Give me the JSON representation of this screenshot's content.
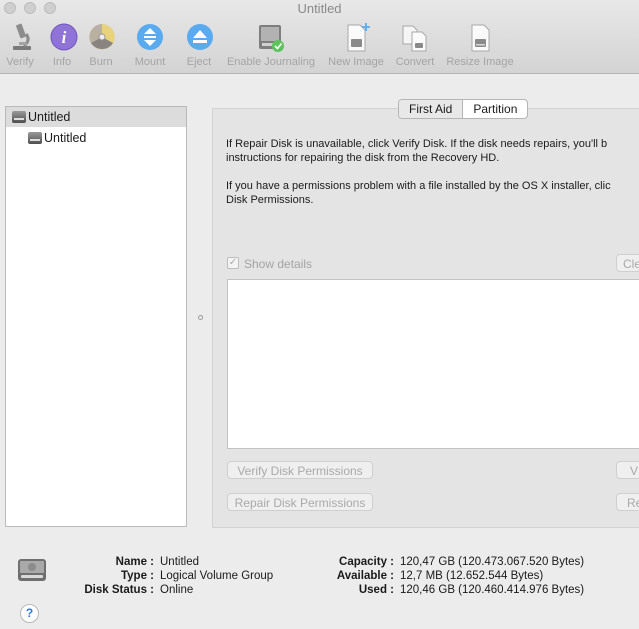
{
  "window": {
    "title": "Untitled"
  },
  "toolbar": {
    "items": [
      {
        "label": "Verify",
        "icon": "microscope-icon"
      },
      {
        "label": "Info",
        "icon": "info-icon"
      },
      {
        "label": "Burn",
        "icon": "burn-disc-icon"
      },
      {
        "label": "Mount",
        "icon": "mount-icon"
      },
      {
        "label": "Eject",
        "icon": "eject-icon"
      },
      {
        "label": "Enable Journaling",
        "icon": "journaling-icon"
      },
      {
        "label": "New Image",
        "icon": "new-image-icon"
      },
      {
        "label": "Convert",
        "icon": "convert-icon"
      },
      {
        "label": "Resize Image",
        "icon": "resize-image-icon"
      }
    ]
  },
  "sidebar": {
    "items": [
      {
        "label": "Untitled",
        "level": 0,
        "selected": true
      },
      {
        "label": "Untitled",
        "level": 1,
        "selected": false
      }
    ]
  },
  "tabs": [
    {
      "label": "First Aid",
      "active": true
    },
    {
      "label": "Partition",
      "active": false
    }
  ],
  "first_aid": {
    "para1_line1": "If Repair Disk is unavailable, click Verify Disk. If the disk needs repairs, you'll b",
    "para1_line2": "instructions for repairing the disk from the Recovery HD.",
    "para2_line1": "If you have a permissions problem with a file installed by the OS X installer, clic",
    "para2_line2": "Disk Permissions.",
    "show_details_label": "Show details",
    "show_details_checked": true,
    "clear_history_label": "Cle",
    "verify_permissions_label": "Verify Disk Permissions",
    "repair_permissions_label": "Repair Disk Permissions",
    "verify_disk_label": "V",
    "repair_disk_label": "Re"
  },
  "info": {
    "name_label": "Name :",
    "name_value": "Untitled",
    "type_label": "Type :",
    "type_value": "Logical Volume Group",
    "status_label": "Disk Status :",
    "status_value": "Online",
    "capacity_label": "Capacity :",
    "capacity_value": "120,47 GB (120.473.067.520 Bytes)",
    "available_label": "Available :",
    "available_value": "12,7 MB (12.652.544 Bytes)",
    "used_label": "Used :",
    "used_value": "120,46 GB (120.460.414.976 Bytes)"
  },
  "help": {
    "glyph": "?"
  },
  "colors": {
    "accent": "#2d7ae8",
    "toolbar_blue": "#4a9fe8",
    "check_green": "#5cc25c"
  }
}
